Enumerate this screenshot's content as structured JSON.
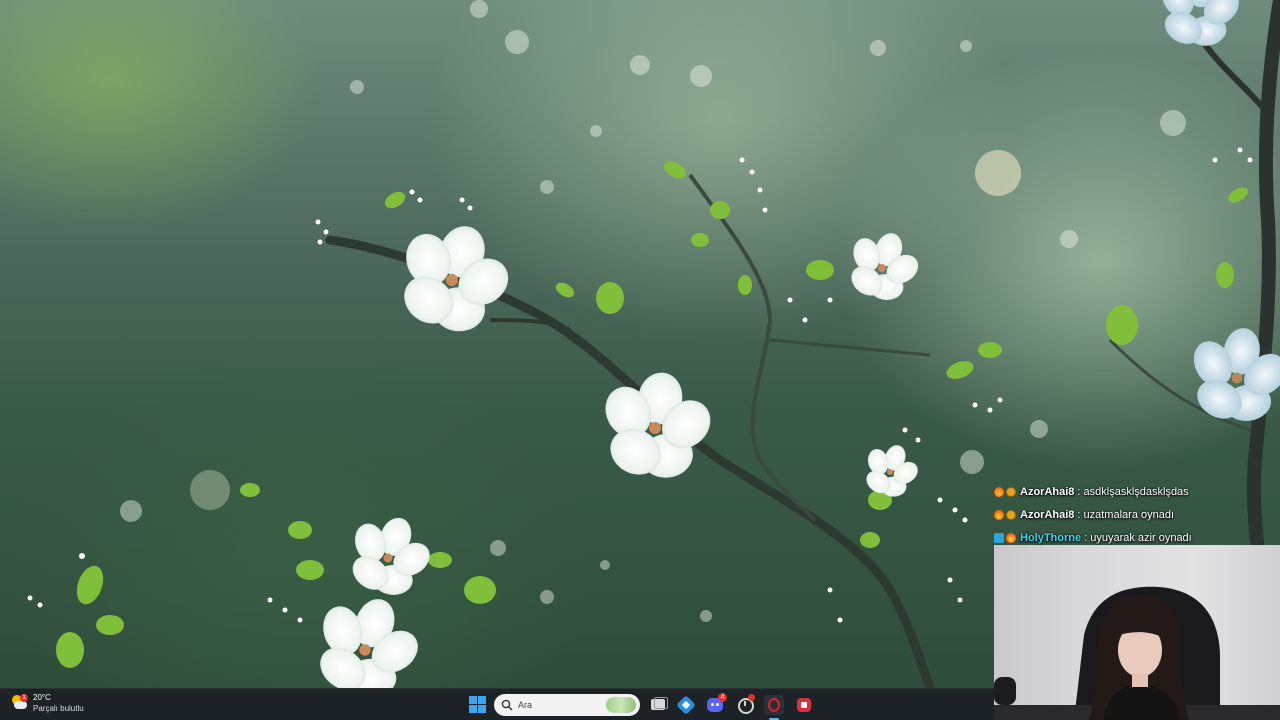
{
  "chat": [
    {
      "username": "AzorAhai8",
      "message": ": asdklşasklşdasklşdas",
      "name_color": "#ffffff",
      "badges": [
        "fire-badge",
        "gold-badge"
      ]
    },
    {
      "username": "AzorAhai8",
      "message": ": uzatmalara oynadı",
      "name_color": "#ffffff",
      "badges": [
        "fire-badge",
        "gold-badge"
      ]
    },
    {
      "username": "HolyThorne",
      "message": ": uyuyarak azir oynadı",
      "name_color": "#3fd3f0",
      "badges": [
        "blue-badge",
        "fire-badge"
      ]
    }
  ],
  "taskbar": {
    "weather": {
      "temperature": "20°C",
      "condition": "Parçalı bulutlu",
      "icon": "partly-cloudy-icon",
      "alert_count": "1"
    },
    "search": {
      "placeholder": "Ara"
    },
    "icons": [
      "windows-start-icon",
      "task-view-icon",
      "network-app-icon",
      "discord-icon",
      "clock-app-icon",
      "opera-gx-icon",
      "app-icon"
    ],
    "discord_badge": "4"
  },
  "colors": {
    "taskbar_bg": "#1c2226",
    "accent": "#59b5f5",
    "chat_highlight": "#3fd3f0"
  }
}
